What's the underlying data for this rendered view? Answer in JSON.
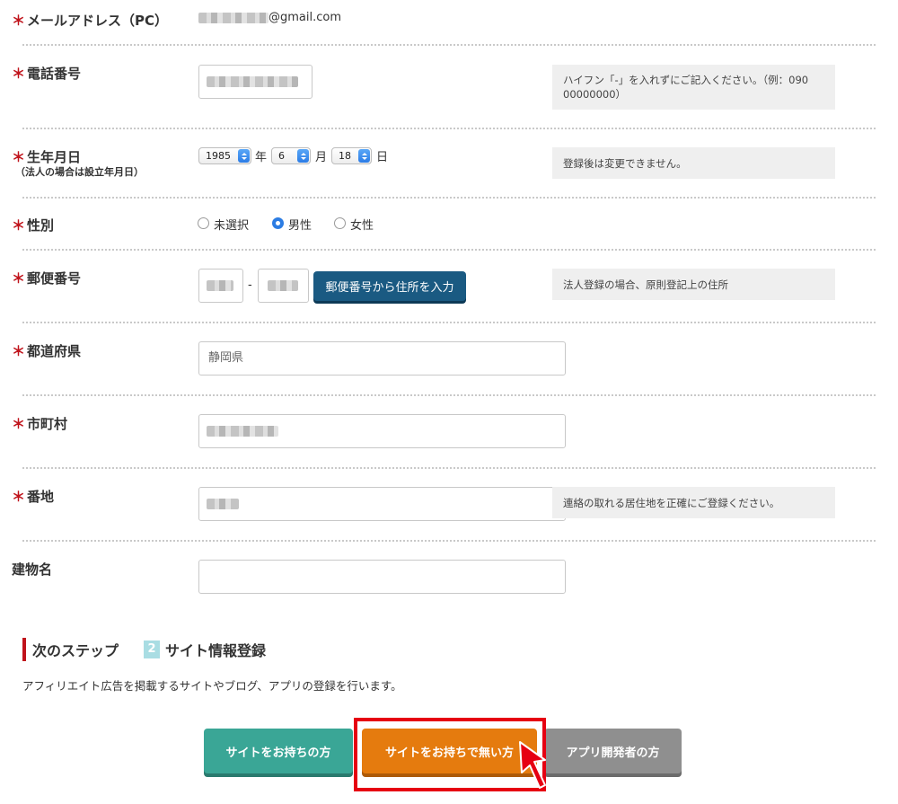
{
  "form": {
    "email": {
      "label": "メールアドレス（PC）",
      "value": "@gmail.com"
    },
    "phone": {
      "label": "電話番号",
      "note": "ハイフン「-」を入れずにご記入ください。（例：090 00000000）"
    },
    "birthdate": {
      "label": "生年月日",
      "sublabel": "（法人の場合は設立年月日）",
      "year": "1985",
      "year_unit": "年",
      "month": "6",
      "month_unit": "月",
      "day": "18",
      "day_unit": "日",
      "note": "登録後は変更できません。"
    },
    "gender": {
      "label": "性別",
      "options": [
        "未選択",
        "男性",
        "女性"
      ],
      "selected": "男性"
    },
    "postal": {
      "label": "郵便番号",
      "separator": "-",
      "lookup_button": "郵便番号から住所を入力",
      "note": "法人登録の場合、原則登記上の住所"
    },
    "prefecture": {
      "label": "都道府県",
      "value": "静岡県"
    },
    "city": {
      "label": "市町村"
    },
    "address": {
      "label": "番地",
      "note": "連絡の取れる居住地を正確にご登録ください。"
    },
    "building": {
      "label": "建物名",
      "value": ""
    },
    "required_mark": "＊"
  },
  "next_step": {
    "heading": "次のステップ",
    "step_number": "2",
    "step_title": "サイト情報登録",
    "description": "アフィリエイト広告を掲載するサイトやブログ、アプリの登録を行います。"
  },
  "buttons": {
    "has_site": "サイトをお持ちの方",
    "no_site": "サイトをお持ちで無い方",
    "app_dev": "アプリ開発者の方"
  },
  "colors": {
    "required": "#c0131b",
    "zip_button": "#1a5a82",
    "green_button": "#3aa696",
    "orange_button": "#e57b0e",
    "gray_button": "#8f8f8f",
    "highlight": "#e60012"
  }
}
